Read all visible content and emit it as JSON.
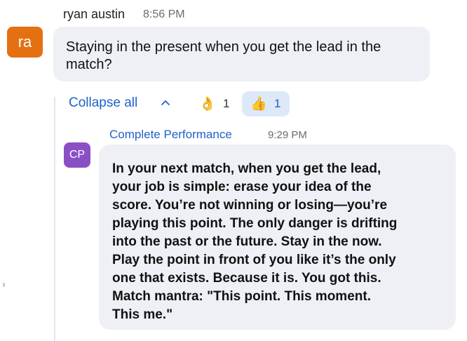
{
  "message": {
    "avatar_initials": "ra",
    "avatar_color": "#e47012",
    "sender": "ryan austin",
    "time": "8:56 PM",
    "text": "Staying in the present when you get the lead in the match?"
  },
  "thread_controls": {
    "collapse_label": "Collapse all",
    "collapse_icon": "chevron-up-icon",
    "reactions": [
      {
        "emoji": "👌",
        "icon": "ok-hand-icon",
        "count": "1",
        "selected": false
      },
      {
        "emoji": "👍",
        "icon": "thumbs-up-icon",
        "count": "1",
        "selected": true
      }
    ]
  },
  "reply": {
    "avatar_initials": "CP",
    "avatar_color": "#8b4fc5",
    "sender": "Complete Performance",
    "time": "9:29 PM",
    "lines": [
      "In your next match, when you get the lead,",
      "your job is simple: erase your idea of the",
      "score. You’re not winning or losing—you’re",
      "playing this point. The only danger is drifting",
      "into the past or the future. Stay in the now.",
      "Play the point in front of you like it’s the only",
      "one that exists. Because it is. You got this.",
      "Match mantra: \"This point. This moment.",
      "This me.\""
    ]
  },
  "colors": {
    "link_blue": "#1f62c7",
    "bubble_bg": "#eef0f5",
    "selected_reaction_bg": "#dde9f8"
  }
}
